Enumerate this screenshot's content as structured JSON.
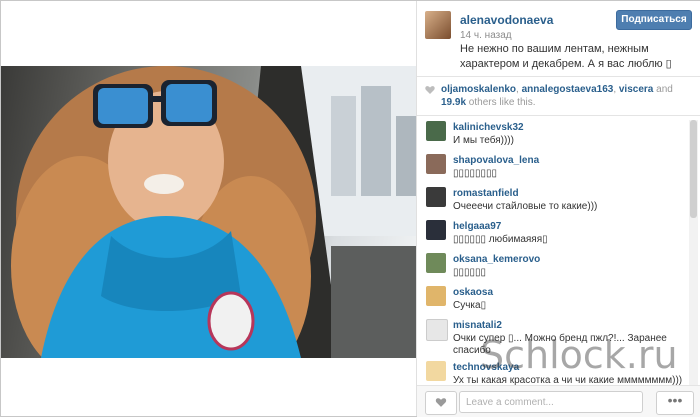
{
  "post": {
    "username": "alenavodonaeva",
    "time_ago": "14 ч. назад",
    "follow_label": "Подписаться",
    "caption": "Не нежно по вашим лентам, нежным характером и декабрем. А я вас люблю ▯"
  },
  "likes": {
    "likers": [
      "oljamoskalenko",
      "annalegostaeva163",
      "viscera"
    ],
    "separator_1": ", ",
    "separator_2": ", ",
    "and": " and ",
    "count": "19.9k",
    "others_text": " others like this."
  },
  "comments": [
    {
      "user": "kalinichevsk32",
      "text": "И мы тебя))))"
    },
    {
      "user": "shapovalova_lena",
      "text": "▯▯▯▯▯▯▯▯"
    },
    {
      "user": "romastanfield",
      "text": "Очееечи стайловые то какие)))"
    },
    {
      "user": "helgaaa97",
      "text": "▯▯▯▯▯▯ любимаяяя▯"
    },
    {
      "user": "oksana_kemerovo",
      "text": "▯▯▯▯▯▯"
    },
    {
      "user": "oskaosa",
      "text": "Сучка▯"
    },
    {
      "user": "misnatali2",
      "text": "Очки супер ▯... Можно бренд пжл?!... Заранее спасибо"
    },
    {
      "user": "technovskaya",
      "text": "Ух ты какая красотка а чи чи какие мммммммм)))"
    }
  ],
  "comment_input": {
    "placeholder": "Leave a comment..."
  },
  "more_label": "•••",
  "watermark": "Schlock.ru",
  "colors": {
    "username": "#2a5f8c",
    "follow_button": "#4e7eb0",
    "muted": "#999999"
  }
}
